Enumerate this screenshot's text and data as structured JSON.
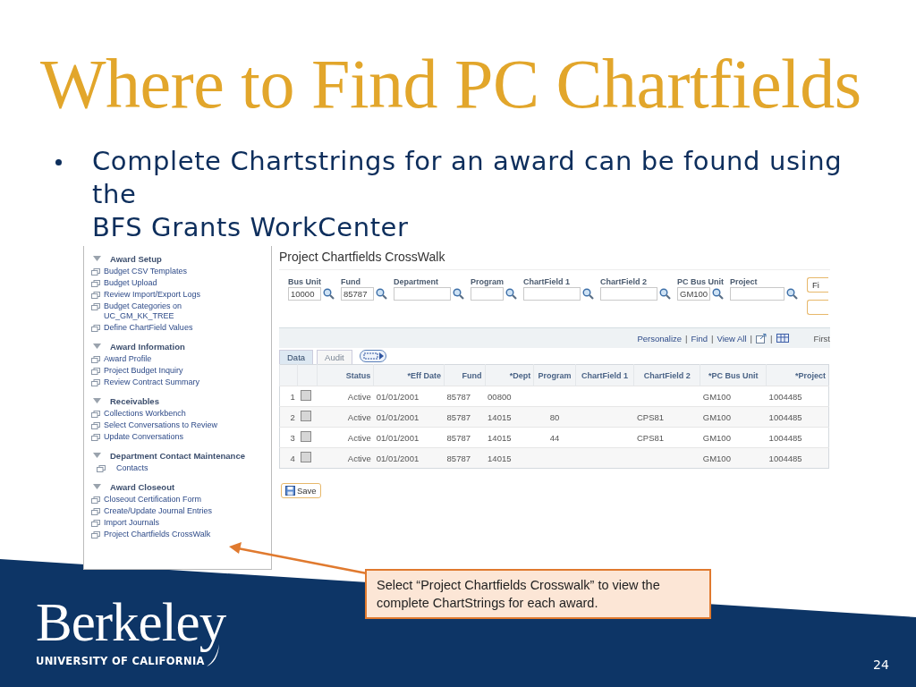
{
  "slide": {
    "title": "Where to Find PC Chartfields",
    "bullet": {
      "lines": [
        "Complete Chartstrings for an award can be found using",
        "the",
        "BFS Grants WorkCenter"
      ]
    }
  },
  "screenshot": {
    "nav": {
      "groups": [
        {
          "label": "Award Setup",
          "expanded": true,
          "items": [
            {
              "label": "Budget CSV Templates"
            },
            {
              "label": "Budget Upload"
            },
            {
              "label": "Review Import/Export Logs"
            },
            {
              "label": "Budget Categories on UC_GM_KK_TREE"
            },
            {
              "label": "Define ChartField Values"
            }
          ]
        },
        {
          "label": "Award Information",
          "expanded": true,
          "items": [
            {
              "label": "Award Profile"
            },
            {
              "label": "Project Budget Inquiry"
            },
            {
              "label": "Review Contract Summary"
            }
          ]
        },
        {
          "label": "Receivables",
          "expanded": true,
          "items": [
            {
              "label": "Collections Workbench"
            },
            {
              "label": "Select Conversations to Review"
            },
            {
              "label": "Update Conversations"
            }
          ]
        },
        {
          "label": "Department Contact Maintenance",
          "expanded": true,
          "items": [
            {
              "label": "Contacts",
              "indented": true
            }
          ]
        },
        {
          "label": "Award Closeout",
          "expanded": true,
          "items": [
            {
              "label": "Closeout Certification Form"
            },
            {
              "label": "Create/Update Journal Entries"
            },
            {
              "label": "Import Journals"
            },
            {
              "label": "Project Chartfields CrossWalk"
            }
          ]
        }
      ]
    },
    "page": {
      "title": "Project Chartfields CrossWalk",
      "fields": [
        {
          "label": "Bus Unit",
          "value": "10000"
        },
        {
          "label": "Fund",
          "value": "85787"
        },
        {
          "label": "Department"
        },
        {
          "label": "Program"
        },
        {
          "label": "ChartField 1"
        },
        {
          "label": "ChartField 2"
        },
        {
          "label": "PC Bus Unit",
          "value": "GM100"
        },
        {
          "label": "Project"
        }
      ],
      "side_button": "Fi",
      "grid_links": [
        "Personalize",
        "Find",
        "View All"
      ],
      "separator": "|",
      "grid_nav": "First",
      "tabs": [
        {
          "label": "Data",
          "selected": true
        },
        {
          "label": "Audit",
          "selected": false
        }
      ],
      "columns": [
        "Status",
        "*Eff Date",
        "Fund",
        "*Dept",
        "Program",
        "ChartField 1",
        "ChartField 2",
        "*PC Bus Unit",
        "*Project"
      ],
      "rows": [
        {
          "number": "1",
          "checked": false,
          "cells": [
            "Active",
            "01/01/2001",
            "85787",
            "00800",
            "",
            "",
            "",
            "GM100",
            "1004485"
          ]
        },
        {
          "number": "2",
          "checked": false,
          "cells": [
            "Active",
            "01/01/2001",
            "85787",
            "14015",
            "80",
            "",
            "CPS81",
            "GM100",
            "1004485"
          ]
        },
        {
          "number": "3",
          "checked": false,
          "cells": [
            "Active",
            "01/01/2001",
            "85787",
            "14015",
            "44",
            "",
            "CPS81",
            "GM100",
            "1004485"
          ]
        },
        {
          "number": "4",
          "checked": false,
          "cells": [
            "Active",
            "01/01/2001",
            "85787",
            "14015",
            "",
            "",
            "",
            "GM100",
            "1004485"
          ]
        }
      ],
      "save_button": "Save"
    }
  },
  "callout": {
    "text": "Select “Project Chartfields Crosswalk” to view the complete ChartStrings for each award."
  },
  "logo": {
    "wordmark": "Berkeley",
    "subtitle": "UNIVERSITY OF CALIFORNIA"
  },
  "page_number": "24"
}
